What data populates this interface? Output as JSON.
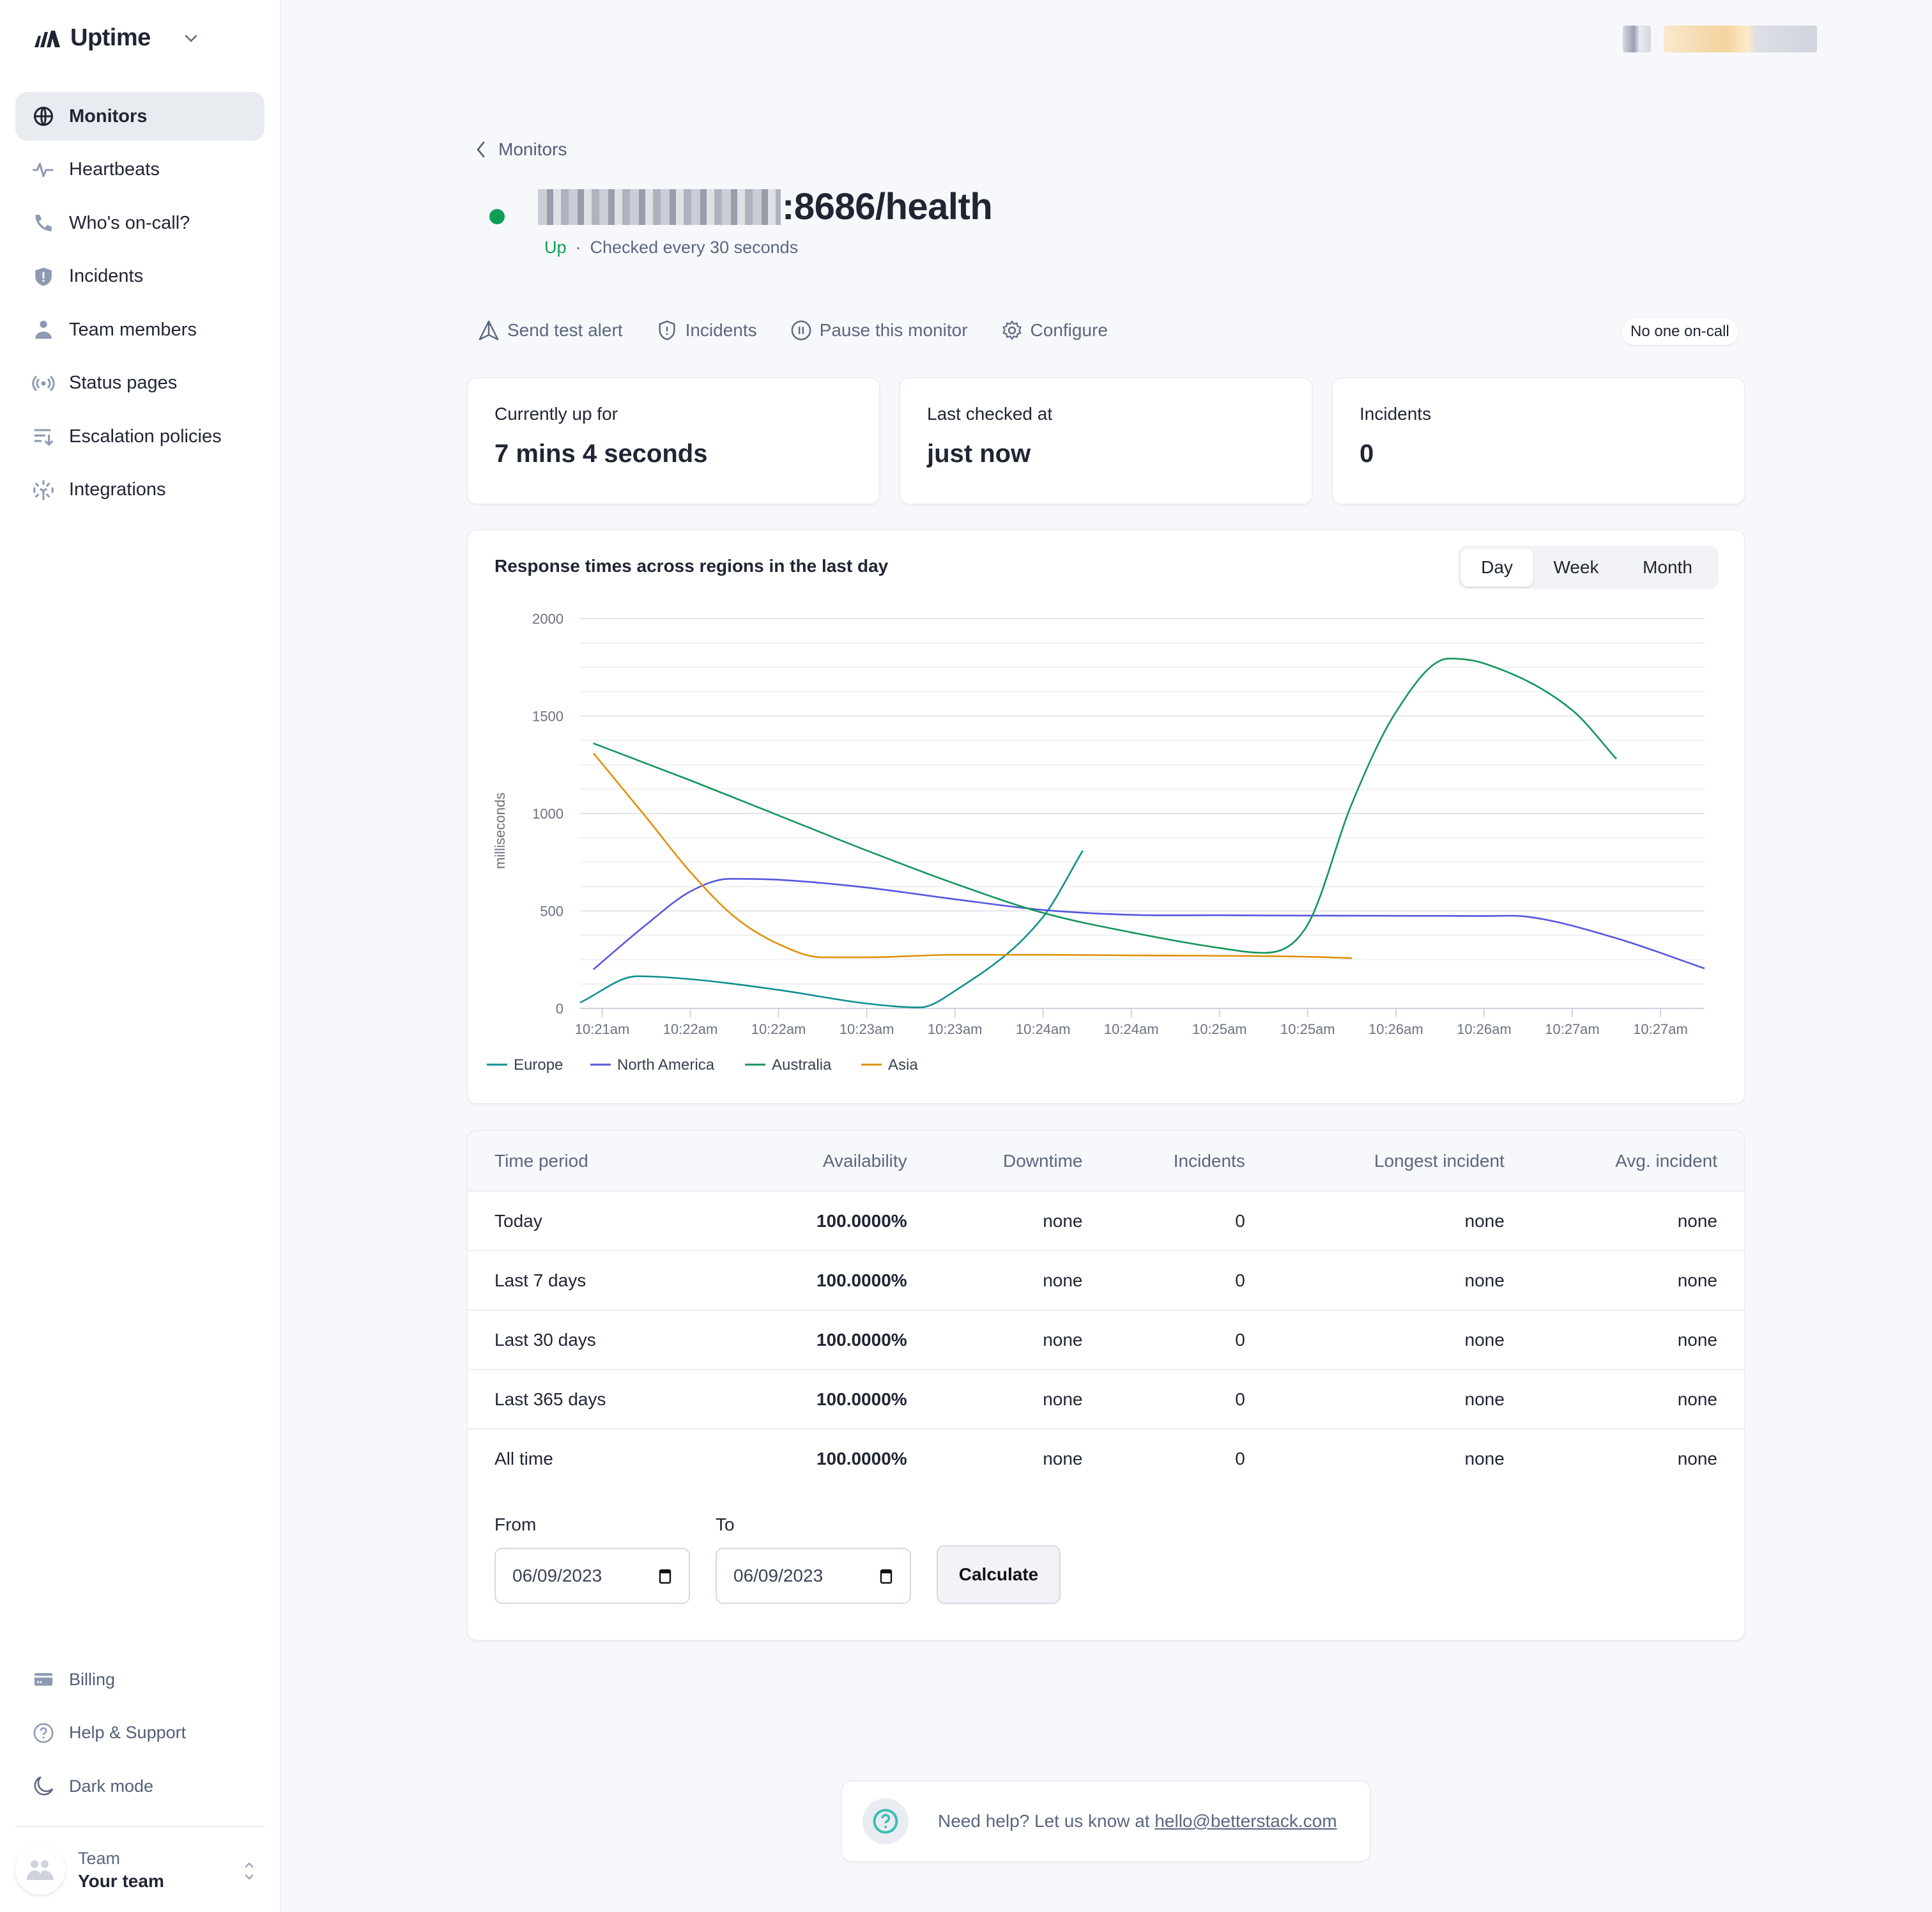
{
  "app": {
    "name": "Uptime",
    "accent": "#0e9f57"
  },
  "sidebar": {
    "items": [
      {
        "label": "Monitors",
        "icon": "globe-icon",
        "active": true
      },
      {
        "label": "Heartbeats",
        "icon": "heartbeat-icon"
      },
      {
        "label": "Who's on-call?",
        "icon": "phone-icon"
      },
      {
        "label": "Incidents",
        "icon": "shield-alert-icon"
      },
      {
        "label": "Team members",
        "icon": "person-icon"
      },
      {
        "label": "Status pages",
        "icon": "broadcast-icon"
      },
      {
        "label": "Escalation policies",
        "icon": "escalation-icon"
      },
      {
        "label": "Integrations",
        "icon": "integrations-icon"
      }
    ],
    "bottom_items": [
      {
        "label": "Billing",
        "icon": "credit-card-icon"
      },
      {
        "label": "Help & Support",
        "icon": "help-circle-icon"
      },
      {
        "label": "Dark mode",
        "icon": "moon-icon"
      }
    ],
    "team": {
      "label": "Team",
      "name": "Your team"
    }
  },
  "header": {
    "back_label": "Monitors",
    "monitor_title_visible": ":8686/health",
    "status": "Up",
    "separator": "·",
    "check_interval": "Checked every 30 seconds",
    "oncall_badge": "No one on-call"
  },
  "actions": [
    {
      "label": "Send test alert",
      "icon": "alert-triangle-icon"
    },
    {
      "label": "Incidents",
      "icon": "shield-alert-icon"
    },
    {
      "label": "Pause this monitor",
      "icon": "pause-circle-icon"
    },
    {
      "label": "Configure",
      "icon": "gear-icon"
    }
  ],
  "stats": [
    {
      "label": "Currently up for",
      "value": "7 mins 4 seconds"
    },
    {
      "label": "Last checked at",
      "value": "just now"
    },
    {
      "label": "Incidents",
      "value": "0"
    }
  ],
  "chart_card": {
    "range_tabs": [
      "Day",
      "Week",
      "Month"
    ],
    "active_range": "Day"
  },
  "chart_data": {
    "type": "line",
    "title": "Response times across regions in the last day",
    "xlabel": "",
    "ylabel": "milliseconds",
    "ylim": [
      0,
      2000
    ],
    "yticks": [
      0,
      500,
      1000,
      1500,
      2000
    ],
    "grid": true,
    "legend": "bottom-left",
    "x_tick_labels": [
      "10:21am",
      "10:22am",
      "10:22am",
      "10:23am",
      "10:23am",
      "10:24am",
      "10:24am",
      "10:25am",
      "10:25am",
      "10:26am",
      "10:26am",
      "10:27am",
      "10:27am"
    ],
    "x_range": [
      -0.25,
      12.5
    ],
    "series": [
      {
        "name": "Europe",
        "color": "#0f8f8f",
        "x": [
          -0.25,
          0.4,
          1.0,
          2.0,
          3.0,
          3.6,
          4.0,
          5.0,
          5.45
        ],
        "y": [
          30,
          165,
          150,
          95,
          25,
          5,
          90,
          470,
          810
        ]
      },
      {
        "name": "North America",
        "color": "#5656e0",
        "x": [
          -0.1,
          0.5,
          1.0,
          1.45,
          2.0,
          3.0,
          4.0,
          5.0,
          6.0,
          7.0,
          8.0,
          9.0,
          10.0,
          10.5,
          11.5,
          12.5
        ],
        "y": [
          200,
          430,
          600,
          665,
          660,
          620,
          560,
          505,
          480,
          478,
          476,
          475,
          474,
          470,
          360,
          205
        ]
      },
      {
        "name": "Australia",
        "color": "#14955a",
        "x": [
          -0.1,
          1.0,
          2.0,
          3.0,
          4.0,
          5.0,
          6.0,
          7.0,
          7.5,
          8.0,
          8.5,
          9.0,
          9.6,
          10.0,
          11.0,
          11.5
        ],
        "y": [
          1360,
          1170,
          990,
          810,
          640,
          490,
          390,
          310,
          285,
          430,
          1050,
          1520,
          1795,
          1770,
          1530,
          1280
        ]
      },
      {
        "name": "Asia",
        "color": "#e0900c",
        "x": [
          -0.1,
          0.5,
          1.0,
          1.5,
          2.0,
          2.5,
          3.0,
          4.0,
          5.0,
          6.0,
          7.0,
          8.0,
          8.5
        ],
        "y": [
          1310,
          980,
          700,
          470,
          330,
          262,
          262,
          275,
          275,
          272,
          270,
          265,
          258
        ]
      }
    ]
  },
  "availability_table": {
    "columns": [
      "Time period",
      "Availability",
      "Downtime",
      "Incidents",
      "Longest incident",
      "Avg. incident"
    ],
    "rows": [
      [
        "Today",
        "100.0000%",
        "none",
        "0",
        "none",
        "none"
      ],
      [
        "Last 7 days",
        "100.0000%",
        "none",
        "0",
        "none",
        "none"
      ],
      [
        "Last 30 days",
        "100.0000%",
        "none",
        "0",
        "none",
        "none"
      ],
      [
        "Last 365 days",
        "100.0000%",
        "none",
        "0",
        "none",
        "none"
      ],
      [
        "All time",
        "100.0000%",
        "none",
        "0",
        "none",
        "none"
      ]
    ]
  },
  "range_form": {
    "from_label": "From",
    "from_value": "06/09/2023",
    "to_label": "To",
    "to_value": "06/09/2023",
    "calculate_label": "Calculate"
  },
  "help": {
    "text": "Need help? Let us know at ",
    "email": "hello@betterstack.com"
  }
}
